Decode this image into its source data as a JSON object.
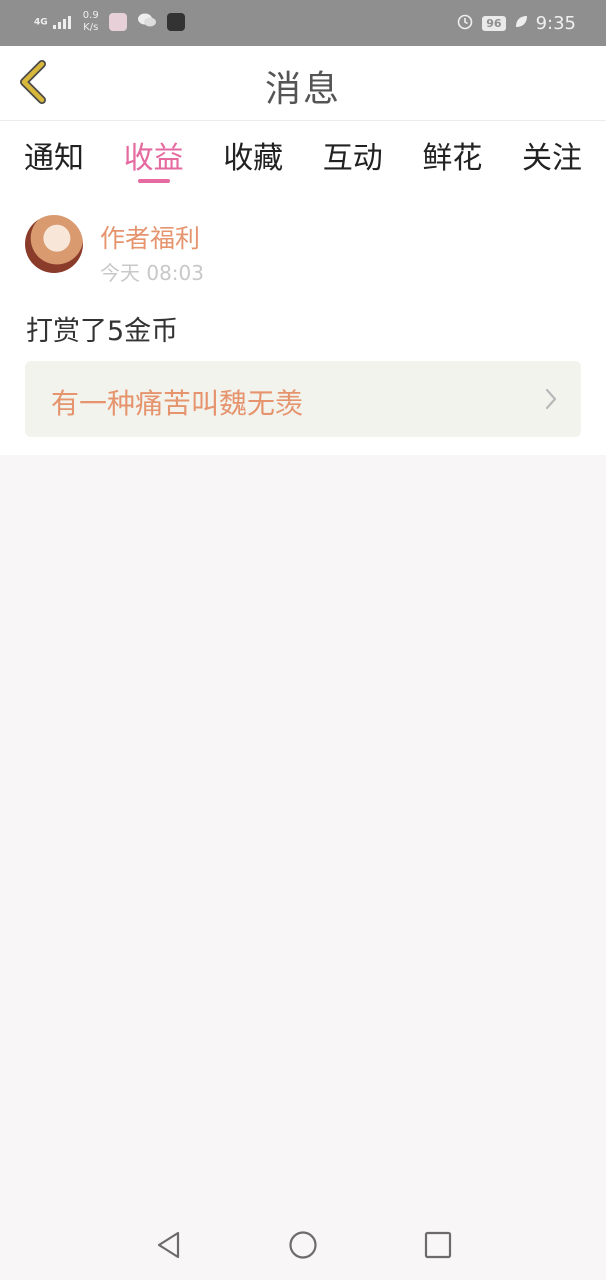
{
  "status_bar": {
    "network": "4G",
    "speed_value": "0.9",
    "speed_unit": "K/s",
    "battery": "96",
    "time": "9:35"
  },
  "header": {
    "title": "消息"
  },
  "tabs": [
    {
      "label": "通知"
    },
    {
      "label": "收益",
      "active": true
    },
    {
      "label": "收藏"
    },
    {
      "label": "互动"
    },
    {
      "label": "鲜花"
    },
    {
      "label": "关注"
    }
  ],
  "message": {
    "sender": "作者福利",
    "time": "今天 08:03",
    "content": "打赏了5金币",
    "book_title": "有一种痛苦叫魏无羡"
  },
  "colors": {
    "accent": "#e46aa0",
    "sender": "#e5946e",
    "back_icon": "#d2b23c"
  }
}
